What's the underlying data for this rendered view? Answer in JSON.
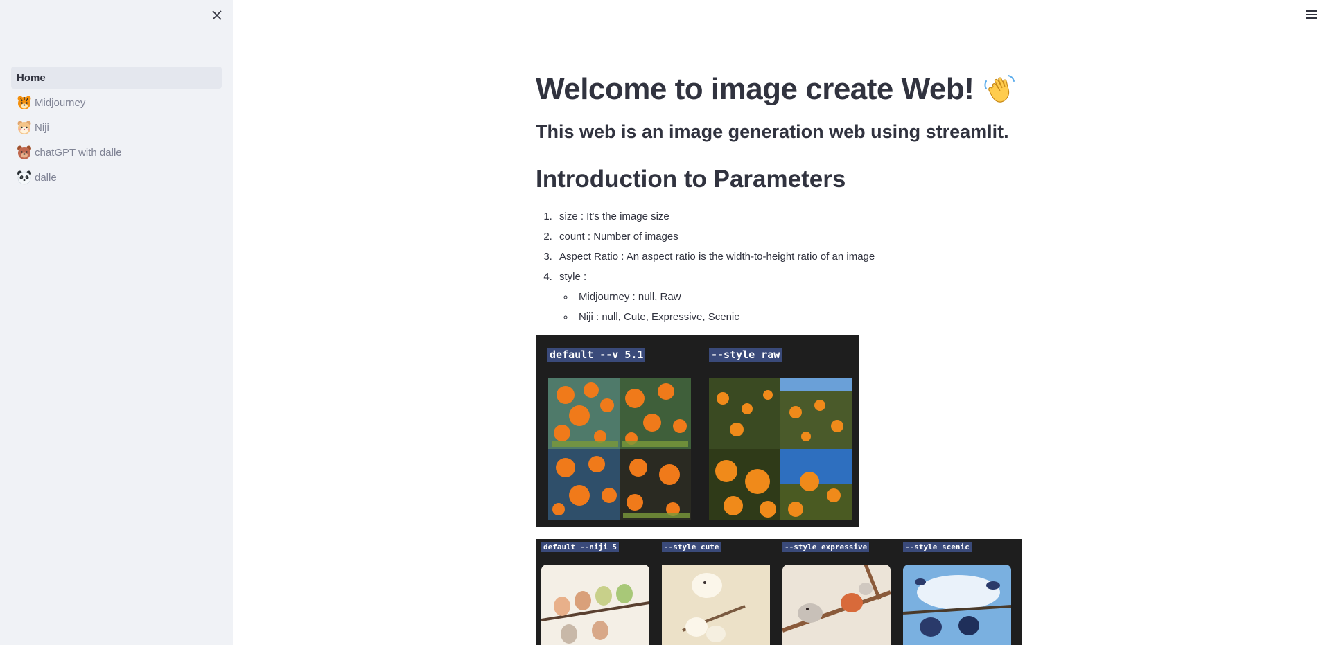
{
  "sidebar": {
    "items": [
      {
        "label": "Home",
        "icon": "none",
        "active": true
      },
      {
        "label": "Midjourney",
        "icon": "tiger-face-icon"
      },
      {
        "label": "Niji",
        "icon": "hamster-face-icon"
      },
      {
        "label": "chatGPT with dalle",
        "icon": "bear-face-icon"
      },
      {
        "label": "dalle",
        "icon": "panda-face-icon"
      }
    ]
  },
  "main": {
    "title": "Welcome to image create Web!",
    "title_emoji": "waving-hand-icon",
    "subtitle": "This web is an image generation web using streamlit.",
    "section_heading": "Introduction to Parameters",
    "params": [
      "size : It's the image size",
      "count : Number of images",
      "Aspect Ratio : An aspect ratio is the width-to-height ratio of an image",
      "style :"
    ],
    "style_options": [
      "Midjourney : null, Raw",
      "Niji : null, Cute, Expressive, Scenic"
    ],
    "midjourney_panel": {
      "labels": [
        "default --v 5.1",
        "--style raw"
      ]
    },
    "niji_panel": {
      "labels": [
        "default --niji 5",
        "--style cute",
        "--style expressive",
        "--style scenic"
      ]
    }
  },
  "colors": {
    "sidebar_bg": "#f0f2f6",
    "text": "#31333f",
    "muted_text": "#808495",
    "panel_bg": "#1e1e1e",
    "tag_bg": "#3a4a7a"
  }
}
